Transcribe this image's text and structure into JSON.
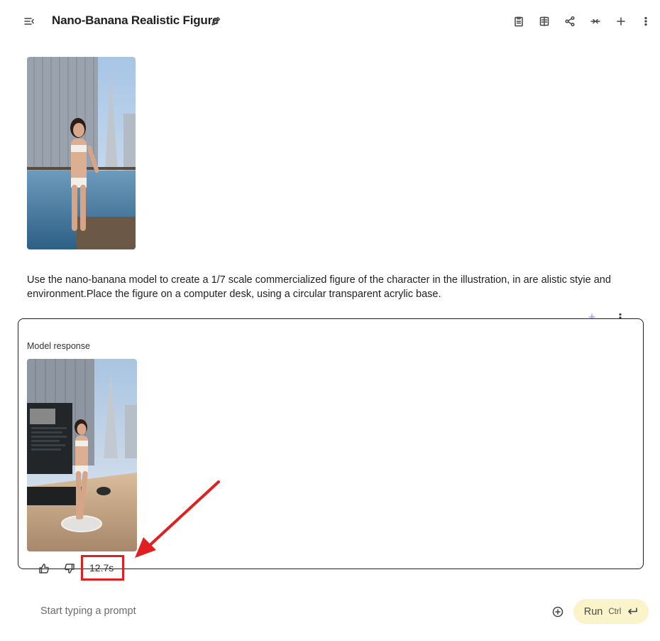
{
  "header": {
    "title": "Nano-Banana Realistic Figure"
  },
  "conversation": {
    "user_prompt": "Use the nano-banana model to create a 1/7 scale commercialized figure of the character in the illustration, in are alistic styie and environment.Place the figure on a computer desk, using a circular transparent acrylic base.",
    "response_label": "Model response",
    "response_time": "12.7s"
  },
  "composer": {
    "placeholder": "Start typing a prompt",
    "run_label": "Run",
    "shortcut": "Ctrl"
  },
  "colors": {
    "accent_run": "#fbf3c9",
    "annotation_red": "#e02020",
    "sparkle": "#a9b7ef"
  },
  "icons": [
    "menu-collapse-icon",
    "pencil-icon",
    "clipboard-icon",
    "compare-icon",
    "share-icon",
    "collapse-icon",
    "plus-icon",
    "more-vert-icon",
    "sparkle-icon",
    "thumb-up-icon",
    "thumb-down-icon",
    "add-circle-icon",
    "enter-key-icon",
    "arrow-annotation"
  ]
}
